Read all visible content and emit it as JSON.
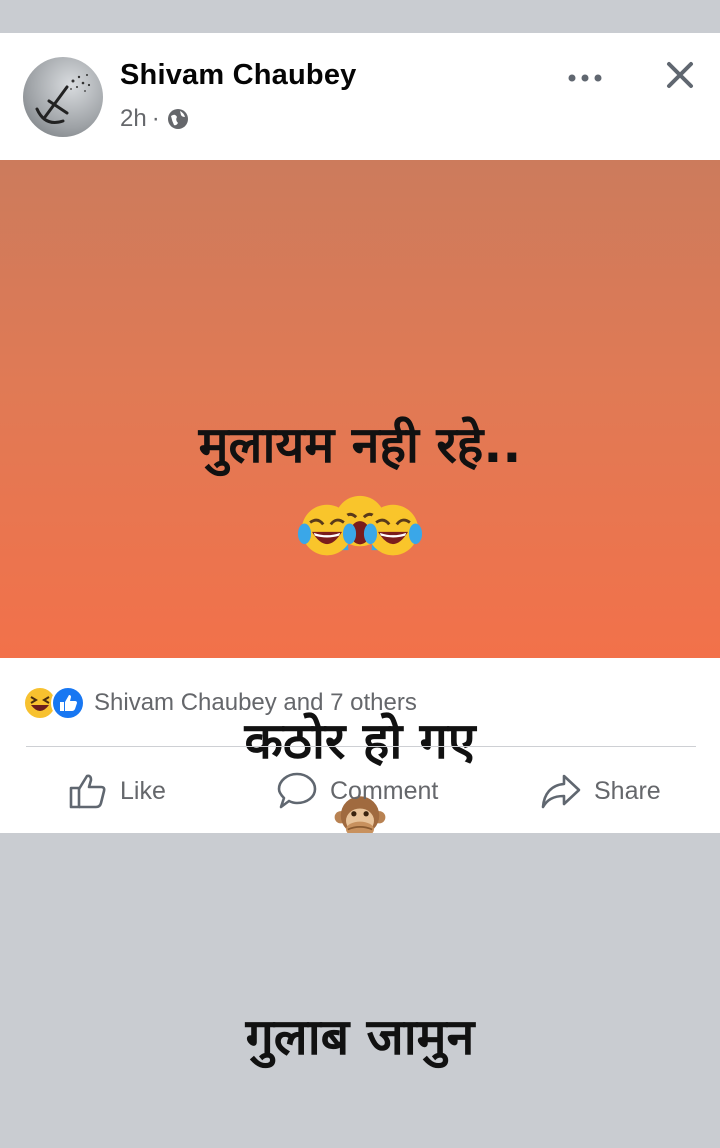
{
  "post": {
    "author": "Shivam Chaubey",
    "time": "2h",
    "separator": "·",
    "text_line1": "मुलायम नही रहे..",
    "text_line2": "कठोर हो गए",
    "text_line3": "गुलाब जामुन",
    "background_top": "#cc7b5c",
    "background_bottom": "#f2714a"
  },
  "reactions": {
    "summary": "Shivam Chaubey and 7 others",
    "icons": [
      "laughing-emoji-icon",
      "like-reaction-icon"
    ]
  },
  "actions": {
    "like": "Like",
    "comment": "Comment",
    "share": "Share"
  },
  "colors": {
    "facebook_blue": "#1877f2",
    "secondary_text": "#65676b"
  }
}
